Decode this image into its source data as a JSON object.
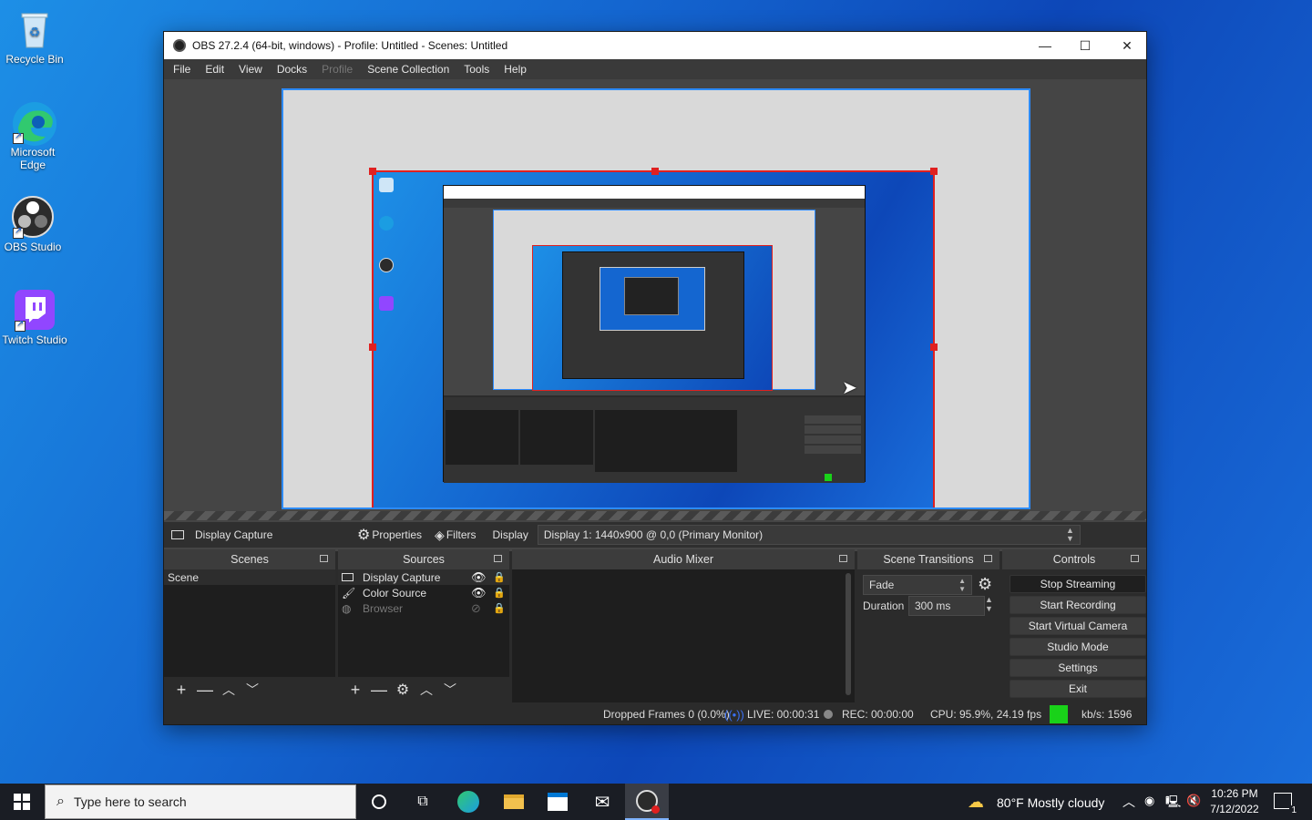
{
  "desktop": {
    "icons": [
      {
        "label": "Recycle Bin"
      },
      {
        "label": "Microsoft Edge"
      },
      {
        "label": "OBS Studio"
      },
      {
        "label": "Twitch Studio"
      }
    ]
  },
  "window": {
    "title": "OBS 27.2.4 (64-bit, windows) - Profile: Untitled - Scenes: Untitled",
    "minimize": "—",
    "maximize": "☐",
    "close": "✕"
  },
  "menu": [
    "File",
    "Edit",
    "View",
    "Docks",
    "Profile",
    "Scene Collection",
    "Tools",
    "Help"
  ],
  "source_toolbar": {
    "selected_source": "Display Capture",
    "properties": "Properties",
    "filters": "Filters",
    "display_label": "Display",
    "display_value": "Display 1: 1440x900 @ 0,0 (Primary Monitor)"
  },
  "scenes": {
    "header": "Scenes",
    "items": [
      "Scene"
    ]
  },
  "sources": {
    "header": "Sources",
    "items": [
      {
        "name": "Display Capture",
        "visible": true
      },
      {
        "name": "Color Source",
        "visible": true
      },
      {
        "name": "Browser",
        "visible": false
      }
    ]
  },
  "audio_mixer": {
    "header": "Audio Mixer"
  },
  "scene_transitions": {
    "header": "Scene Transitions",
    "transition": "Fade",
    "duration_label": "Duration",
    "duration_value": "300 ms"
  },
  "controls": {
    "header": "Controls",
    "buttons": [
      "Stop Streaming",
      "Start Recording",
      "Start Virtual Camera",
      "Studio Mode",
      "Settings",
      "Exit"
    ]
  },
  "status": {
    "dropped_frames": "Dropped Frames 0 (0.0%)",
    "live": "LIVE: 00:00:31",
    "rec": "REC: 00:00:00",
    "cpu": "CPU: 95.9%, 24.19 fps",
    "kbs": "kb/s: 1596",
    "stream_health_color": "#19d219"
  },
  "taskbar": {
    "search_placeholder": "Type here to search",
    "weather": "80°F  Mostly cloudy",
    "time": "10:26 PM",
    "date": "7/12/2022",
    "notifications": "1"
  },
  "colors": {
    "accent_selection": "#2c8bff",
    "source_bounds": "#e02020"
  }
}
